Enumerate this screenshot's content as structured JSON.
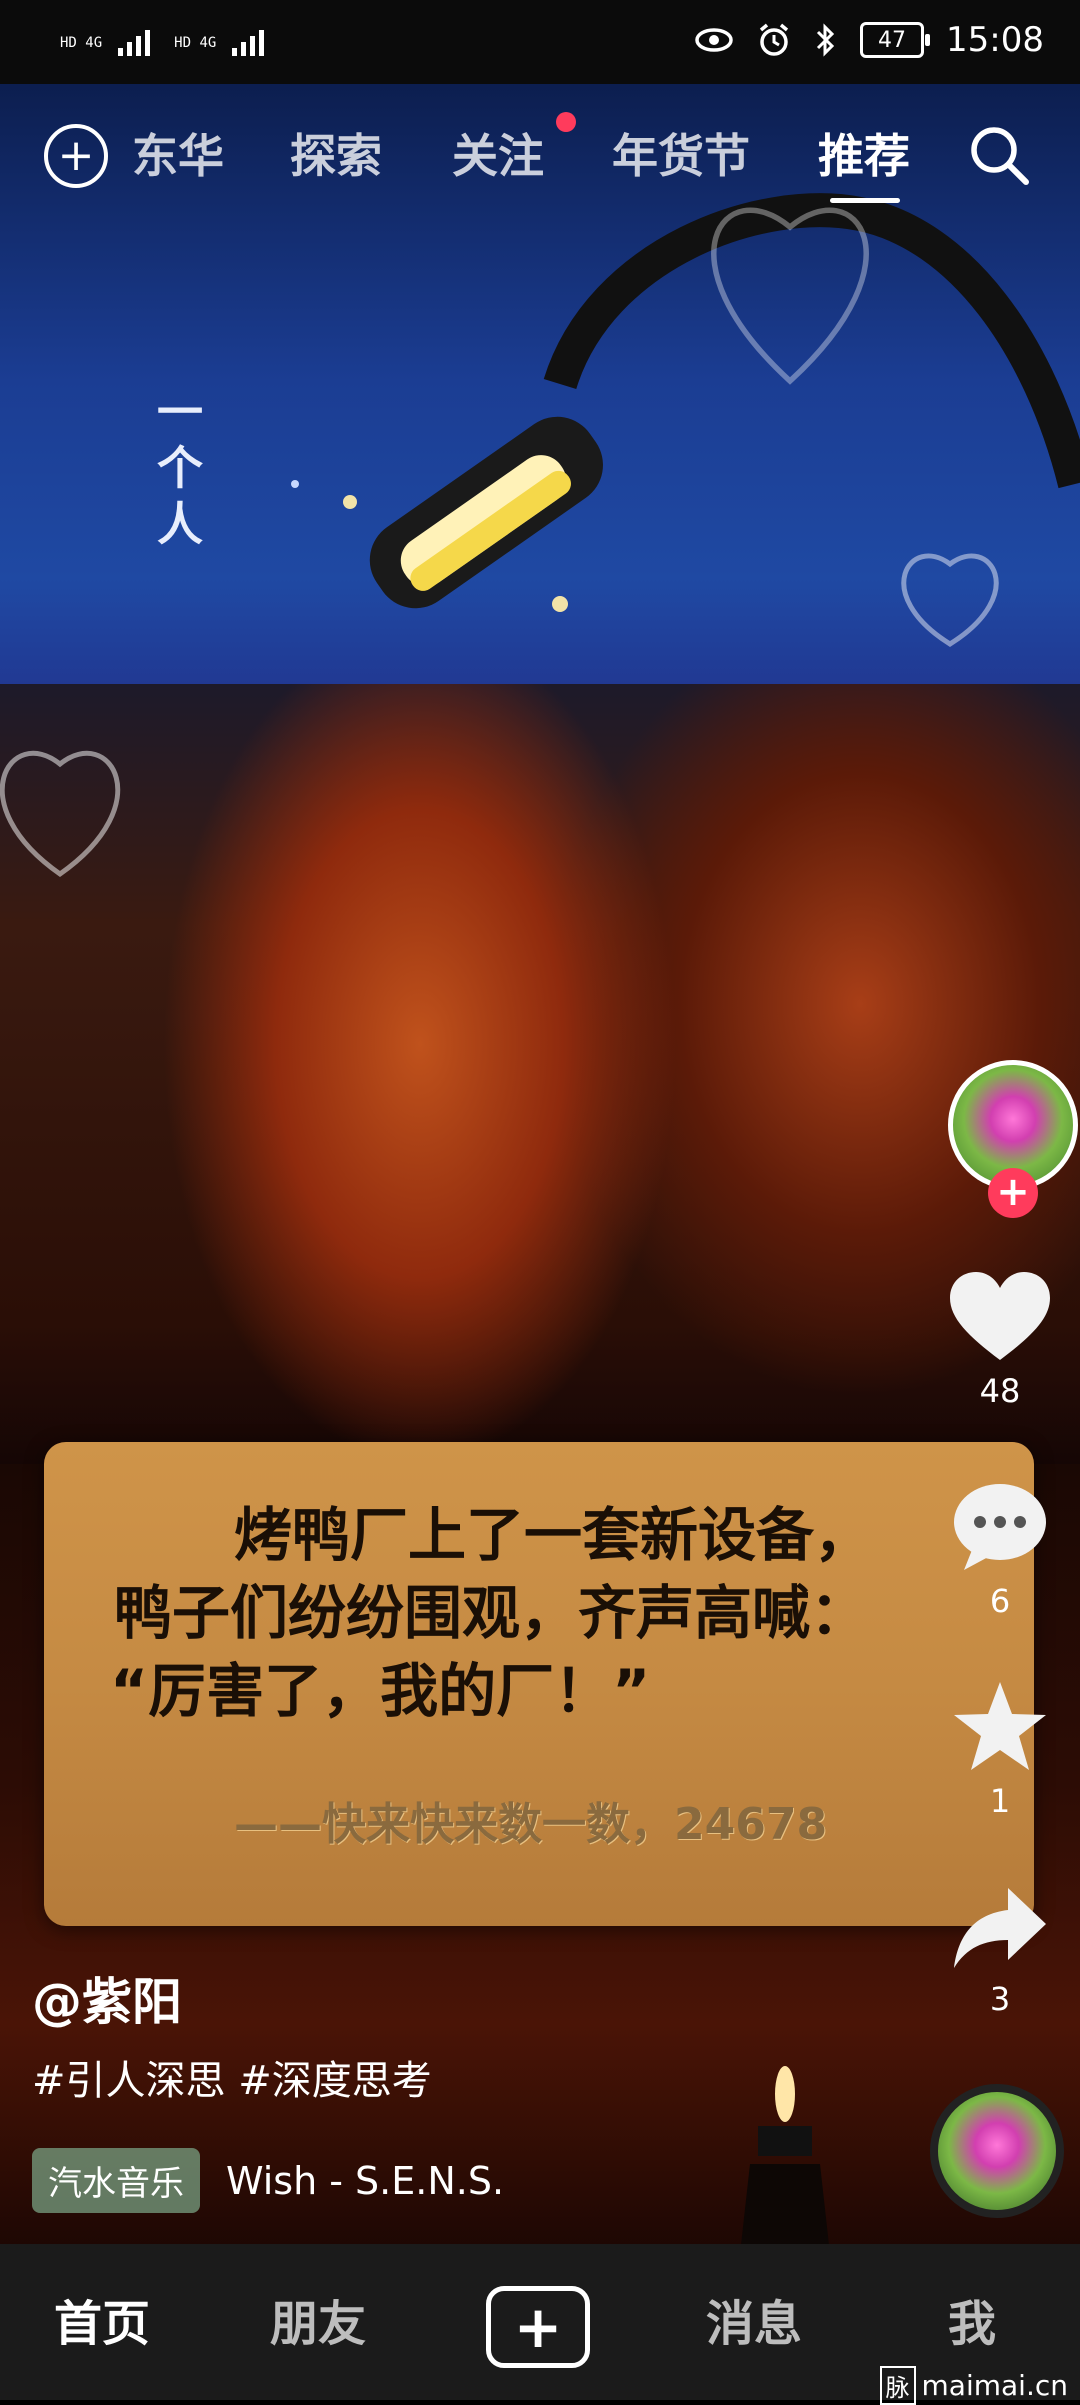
{
  "status_bar": {
    "sim1": "HD 4G",
    "sim2": "HD 4G",
    "battery": "47",
    "time": "15:08"
  },
  "top_nav": {
    "tabs": [
      {
        "label": "东华"
      },
      {
        "label": "探索"
      },
      {
        "label": "关注"
      },
      {
        "label": "年货节"
      },
      {
        "label": "推荐"
      }
    ],
    "active_tab": "推荐"
  },
  "video": {
    "overlay_vertical_text": "一个人",
    "quote_lines": [
      "烤鸭厂上了一套新设备，",
      "鸭子们纷纷围观，齐声高喊：",
      "“厉害了，我的厂！”"
    ],
    "quote_signature": "——快来快来数一数，24678"
  },
  "right_rail": {
    "like_count": "48",
    "comment_count": "6",
    "favorite_count": "1",
    "share_count": "3"
  },
  "info": {
    "author": "@紫阳",
    "tags": "#引人深思 #深度思考",
    "music_badge": "汽水音乐",
    "music_name": "Wish - S.E.N.S."
  },
  "bottom_nav": {
    "items": [
      {
        "label": "首页"
      },
      {
        "label": "朋友"
      },
      {
        "label": "消息"
      },
      {
        "label": "我"
      }
    ]
  },
  "watermark": {
    "badge": "脉",
    "text": "maimai.cn"
  },
  "colors": {
    "accent_red": "#ff3b5c",
    "card_bg": "#c58a43"
  }
}
